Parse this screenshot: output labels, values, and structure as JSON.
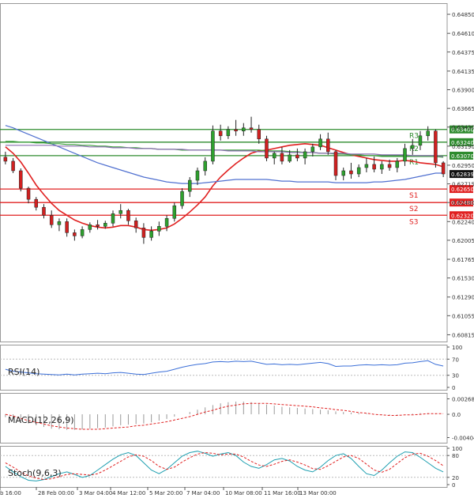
{
  "chart_data": [
    {
      "type": "candlestick",
      "panel": "price",
      "ylim": [
        0.6073,
        0.6499
      ],
      "price_ticks": [
        "0.64850",
        "0.64610",
        "0.64375",
        "0.64135",
        "0.63900",
        "0.63665",
        "0.63430",
        "0.63190",
        "0.62950",
        "0.62715",
        "0.62480",
        "0.62240",
        "0.62005",
        "0.61765",
        "0.61530",
        "0.61290",
        "0.61055",
        "0.60815"
      ],
      "x_ticks": [
        "b 16:00",
        "28 Feb 00:00",
        "3 Mar 04:00",
        "4 Mar 12:00",
        "5 Mar 20:00",
        "7 Mar 04:00",
        "10 Mar 08:00",
        "11 Mar 16:00",
        "13 Mar 00:00"
      ],
      "current_price": {
        "label": "0.62839",
        "value": 0.62839
      },
      "levels": [
        {
          "name": "R3",
          "label": "0.63400",
          "value": 0.634,
          "color": "#2e8b2e"
        },
        {
          "name": "R2",
          "label": "0.63240",
          "value": 0.6324,
          "color": "#2e8b2e"
        },
        {
          "name": "R1",
          "label": "0.63070",
          "value": 0.6307,
          "color": "#2e8b2e"
        },
        {
          "name": "S1",
          "label": "0.62650",
          "value": 0.6265,
          "color": "#e02020"
        },
        {
          "name": "S2",
          "label": "0.62480",
          "value": 0.6248,
          "color": "#e02020"
        },
        {
          "name": "S3",
          "label": "0.62320",
          "value": 0.6232,
          "color": "#e02020"
        }
      ],
      "candles": [
        [
          0.6305,
          0.6312,
          0.6296,
          0.63
        ],
        [
          0.63,
          0.6304,
          0.6285,
          0.6288
        ],
        [
          0.6288,
          0.6291,
          0.6262,
          0.6266
        ],
        [
          0.6266,
          0.6268,
          0.6247,
          0.6252
        ],
        [
          0.6252,
          0.6255,
          0.6238,
          0.6242
        ],
        [
          0.6242,
          0.6246,
          0.6228,
          0.6232
        ],
        [
          0.6232,
          0.6238,
          0.6216,
          0.622
        ],
        [
          0.622,
          0.6228,
          0.6212,
          0.6224
        ],
        [
          0.6224,
          0.6228,
          0.6205,
          0.621
        ],
        [
          0.621,
          0.6214,
          0.62,
          0.6206
        ],
        [
          0.6206,
          0.6218,
          0.6203,
          0.6214
        ],
        [
          0.6214,
          0.6223,
          0.621,
          0.622
        ],
        [
          0.622,
          0.6226,
          0.6214,
          0.6218
        ],
        [
          0.6218,
          0.6225,
          0.6215,
          0.6222
        ],
        [
          0.6222,
          0.6238,
          0.6218,
          0.6234
        ],
        [
          0.6234,
          0.6246,
          0.6228,
          0.6238
        ],
        [
          0.6238,
          0.624,
          0.622,
          0.6225
        ],
        [
          0.6225,
          0.6229,
          0.621,
          0.6216
        ],
        [
          0.6216,
          0.6222,
          0.6196,
          0.6204
        ],
        [
          0.6204,
          0.6218,
          0.62,
          0.6212
        ],
        [
          0.6212,
          0.6224,
          0.6206,
          0.6218
        ],
        [
          0.6218,
          0.6232,
          0.6212,
          0.6228
        ],
        [
          0.6228,
          0.6248,
          0.6224,
          0.6244
        ],
        [
          0.6244,
          0.6266,
          0.624,
          0.6262
        ],
        [
          0.6262,
          0.628,
          0.6255,
          0.6276
        ],
        [
          0.6276,
          0.6292,
          0.627,
          0.6288
        ],
        [
          0.6288,
          0.6305,
          0.6282,
          0.63
        ],
        [
          0.63,
          0.6345,
          0.6296,
          0.6338
        ],
        [
          0.6338,
          0.6346,
          0.6326,
          0.6332
        ],
        [
          0.6332,
          0.6344,
          0.6328,
          0.634
        ],
        [
          0.634,
          0.6352,
          0.6332,
          0.6338
        ],
        [
          0.6338,
          0.6348,
          0.6332,
          0.6342
        ],
        [
          0.6342,
          0.6356,
          0.6336,
          0.634
        ],
        [
          0.634,
          0.6346,
          0.6322,
          0.6328
        ],
        [
          0.6328,
          0.6332,
          0.63,
          0.6304
        ],
        [
          0.6304,
          0.6312,
          0.6296,
          0.631
        ],
        [
          0.631,
          0.6318,
          0.6296,
          0.63
        ],
        [
          0.63,
          0.6314,
          0.6298,
          0.6308
        ],
        [
          0.6308,
          0.6316,
          0.63,
          0.6304
        ],
        [
          0.6304,
          0.6316,
          0.6296,
          0.6312
        ],
        [
          0.6312,
          0.6322,
          0.6306,
          0.6318
        ],
        [
          0.6318,
          0.6334,
          0.6314,
          0.6328
        ],
        [
          0.6328,
          0.6336,
          0.6308,
          0.6312
        ],
        [
          0.6312,
          0.6314,
          0.6276,
          0.6282
        ],
        [
          0.6282,
          0.6292,
          0.6276,
          0.6288
        ],
        [
          0.6288,
          0.6298,
          0.6278,
          0.6284
        ],
        [
          0.6284,
          0.6296,
          0.628,
          0.6292
        ],
        [
          0.6292,
          0.6304,
          0.6286,
          0.6296
        ],
        [
          0.6296,
          0.6306,
          0.6286,
          0.629
        ],
        [
          0.629,
          0.63,
          0.6284,
          0.6296
        ],
        [
          0.6296,
          0.6302,
          0.6288,
          0.6292
        ],
        [
          0.6292,
          0.6304,
          0.6286,
          0.63
        ],
        [
          0.63,
          0.6322,
          0.6294,
          0.6316
        ],
        [
          0.6316,
          0.6328,
          0.6308,
          0.632
        ],
        [
          0.632,
          0.6338,
          0.6314,
          0.6332
        ],
        [
          0.6332,
          0.6344,
          0.6326,
          0.6338
        ],
        [
          0.6338,
          0.634,
          0.6292,
          0.6298
        ],
        [
          0.6298,
          0.63,
          0.628,
          0.6284
        ]
      ],
      "moving_averages": [
        {
          "color": "#e02020",
          "values": [
            0.6318,
            0.631,
            0.6299,
            0.6285,
            0.627,
            0.6258,
            0.6247,
            0.6238,
            0.6232,
            0.6226,
            0.6222,
            0.6219,
            0.6217,
            0.6216,
            0.6217,
            0.6219,
            0.6219,
            0.6217,
            0.6214,
            0.6213,
            0.6214,
            0.6216,
            0.6221,
            0.6228,
            0.6236,
            0.6245,
            0.6255,
            0.6269,
            0.628,
            0.6289,
            0.6297,
            0.6304,
            0.631,
            0.6313,
            0.6314,
            0.6316,
            0.6318,
            0.632,
            0.6321,
            0.6322,
            0.6321,
            0.632,
            0.6317,
            0.6314,
            0.6311,
            0.6308,
            0.6306,
            0.6304,
            0.6302,
            0.6301,
            0.63,
            0.63,
            0.6301,
            0.63,
            0.6298,
            0.6297,
            0.6296,
            0.6293
          ]
        },
        {
          "color": "#5070d0",
          "values": [
            0.6345,
            0.6342,
            0.6338,
            0.6334,
            0.633,
            0.6326,
            0.6322,
            0.6318,
            0.6314,
            0.631,
            0.6306,
            0.6302,
            0.6298,
            0.6295,
            0.6292,
            0.6289,
            0.6286,
            0.6283,
            0.628,
            0.6278,
            0.6276,
            0.6274,
            0.6273,
            0.6272,
            0.6272,
            0.6272,
            0.6273,
            0.6274,
            0.6275,
            0.6276,
            0.6277,
            0.6277,
            0.6277,
            0.6277,
            0.6277,
            0.6276,
            0.6275,
            0.6275,
            0.6274,
            0.6274,
            0.6274,
            0.6274,
            0.6274,
            0.6273,
            0.6273,
            0.6273,
            0.6273,
            0.6273,
            0.6274,
            0.6274,
            0.6275,
            0.6276,
            0.6277,
            0.6279,
            0.6281,
            0.6283,
            0.6285,
            0.6285
          ]
        },
        {
          "color": "#3aa03a",
          "values": [
            0.6325,
            0.6325,
            0.6324,
            0.6324,
            0.6323,
            0.6323,
            0.6322,
            0.6322,
            0.6321,
            0.6321,
            0.632,
            0.632,
            0.6319,
            0.6319,
            0.6318,
            0.6318,
            0.6317,
            0.6317,
            0.6316,
            0.6316,
            0.6315,
            0.6315,
            0.6315,
            0.6314,
            0.6314,
            0.6314,
            0.6314,
            0.6314,
            0.6314,
            0.6314,
            0.6314,
            0.6314,
            0.6314,
            0.6314,
            0.6313,
            0.6313,
            0.6313,
            0.6312,
            0.6312,
            0.6311,
            0.6311,
            0.631,
            0.631,
            0.6309,
            0.6309,
            0.6308,
            0.6308,
            0.6307,
            0.6307,
            0.6306,
            0.6306,
            0.6306,
            0.6306,
            0.6306,
            0.6306,
            0.6306,
            0.6306,
            0.6305
          ]
        },
        {
          "color": "#8a6fb0",
          "values": [
            0.632,
            0.632,
            0.632,
            0.632,
            0.632,
            0.632,
            0.632,
            0.6319,
            0.6319,
            0.6319,
            0.6319,
            0.6318,
            0.6318,
            0.6318,
            0.6317,
            0.6317,
            0.6317,
            0.6316,
            0.6316,
            0.6316,
            0.6315,
            0.6315,
            0.6315,
            0.6315,
            0.6314,
            0.6314,
            0.6314,
            0.6314,
            0.6314,
            0.6313,
            0.6313,
            0.6313,
            0.6313,
            0.6312,
            0.6312,
            0.6312,
            0.6312,
            0.6311,
            0.6311,
            0.6311,
            0.6311,
            0.631,
            0.631,
            0.631,
            0.631,
            0.6309,
            0.6309,
            0.6309,
            0.6309,
            0.6308,
            0.6308,
            0.6308,
            0.6308,
            0.6307,
            0.6307,
            0.6307,
            0.6307,
            0.6306
          ]
        }
      ]
    },
    {
      "type": "line",
      "panel": "rsi",
      "label": "RSI(14)",
      "ylim": [
        0,
        100
      ],
      "ticks": [
        "100",
        "70",
        "30",
        "0"
      ],
      "levels": [
        70,
        30
      ],
      "values": [
        45,
        40,
        38,
        36,
        34,
        33,
        32,
        31,
        33,
        31,
        33,
        34,
        35,
        34,
        36,
        37,
        35,
        33,
        32,
        35,
        38,
        40,
        45,
        50,
        54,
        57,
        59,
        63,
        64,
        63,
        65,
        64,
        65,
        61,
        57,
        58,
        56,
        57,
        56,
        58,
        60,
        62,
        59,
        52,
        53,
        53,
        55,
        56,
        55,
        56,
        55,
        56,
        60,
        61,
        64,
        66,
        57,
        53
      ]
    },
    {
      "type": "line",
      "panel": "macd",
      "label": "MACD(12,26,9)",
      "ylim": [
        -0.00452,
        0.0033
      ],
      "ticks": [
        "0.00268",
        "0.0",
        "-0.00404"
      ],
      "histogram": [
        -0.0005,
        -0.0008,
        -0.0012,
        -0.0016,
        -0.0019,
        -0.0022,
        -0.0025,
        -0.0026,
        -0.0027,
        -0.0027,
        -0.0026,
        -0.0025,
        -0.0024,
        -0.0023,
        -0.0021,
        -0.0019,
        -0.0018,
        -0.0017,
        -0.0016,
        -0.0014,
        -0.0011,
        -0.0008,
        -0.0004,
        0.0,
        0.0004,
        0.0008,
        0.0012,
        0.0016,
        0.0019,
        0.0021,
        0.0022,
        0.0022,
        0.0021,
        0.0019,
        0.0017,
        0.0015,
        0.0013,
        0.0012,
        0.0011,
        0.001,
        0.0009,
        0.0008,
        0.0007,
        0.0005,
        0.0004,
        0.0003,
        0.0002,
        0.0001,
        0.0,
        -0.0001,
        -0.0001,
        -0.0001,
        0.0,
        0.0001,
        0.0002,
        0.0002,
        0.0001,
        0.0
      ],
      "signal": [
        0.0,
        -0.0003,
        -0.0007,
        -0.0011,
        -0.0014,
        -0.0017,
        -0.002,
        -0.0022,
        -0.0024,
        -0.0025,
        -0.0026,
        -0.0026,
        -0.0026,
        -0.0025,
        -0.0024,
        -0.0023,
        -0.0022,
        -0.002,
        -0.0019,
        -0.0017,
        -0.0015,
        -0.0013,
        -0.001,
        -0.0007,
        -0.0004,
        0.0,
        0.0004,
        0.0007,
        0.0011,
        0.0014,
        0.0016,
        0.0018,
        0.0019,
        0.0019,
        0.0019,
        0.0018,
        0.0017,
        0.0016,
        0.0015,
        0.0014,
        0.0013,
        0.0011,
        0.001,
        0.0008,
        0.0007,
        0.0005,
        0.0003,
        0.0002,
        0.0,
        -0.0001,
        -0.0002,
        -0.0002,
        -0.0001,
        -0.0001,
        0.0,
        0.0001,
        0.0001,
        0.0001
      ]
    },
    {
      "type": "line",
      "panel": "stochastic",
      "label": "Stoch(9,6,3)",
      "ylim": [
        0,
        100
      ],
      "ticks": [
        "100",
        "80",
        "20",
        "0"
      ],
      "levels": [
        80,
        20
      ],
      "k": [
        50,
        35,
        22,
        12,
        10,
        14,
        22,
        30,
        35,
        28,
        20,
        25,
        40,
        55,
        70,
        82,
        88,
        80,
        60,
        40,
        30,
        42,
        60,
        78,
        88,
        92,
        86,
        78,
        84,
        88,
        80,
        62,
        50,
        45,
        55,
        68,
        72,
        65,
        50,
        40,
        35,
        48,
        66,
        80,
        85,
        72,
        50,
        30,
        25,
        40,
        60,
        78,
        90,
        88,
        75,
        60,
        45,
        35
      ],
      "d": [
        60,
        48,
        35,
        24,
        18,
        14,
        16,
        22,
        28,
        30,
        28,
        26,
        30,
        40,
        52,
        64,
        76,
        82,
        78,
        66,
        50,
        42,
        48,
        62,
        74,
        84,
        88,
        86,
        82,
        84,
        84,
        76,
        64,
        54,
        50,
        56,
        64,
        68,
        62,
        54,
        44,
        42,
        52,
        64,
        76,
        80,
        72,
        56,
        40,
        34,
        42,
        58,
        74,
        84,
        86,
        78,
        66,
        52
      ]
    }
  ]
}
